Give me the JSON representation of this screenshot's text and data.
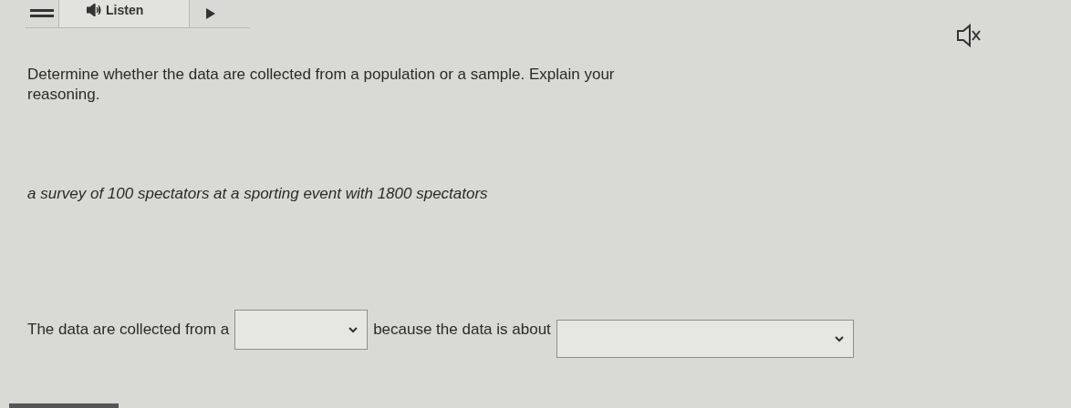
{
  "toolbar": {
    "listen_label": "Listen"
  },
  "question": "Determine whether the data are collected from a population or a sample. Explain your reasoning.",
  "scenario": "a survey of 100 spectators at a sporting event with 1800 spectators",
  "answer": [
    {
      "kind": "text",
      "text": "The data are collected from a"
    },
    {
      "kind": "dropdown"
    },
    {
      "kind": "text",
      "text": "because the data is about"
    },
    {
      "kind": "dropdown"
    }
  ]
}
